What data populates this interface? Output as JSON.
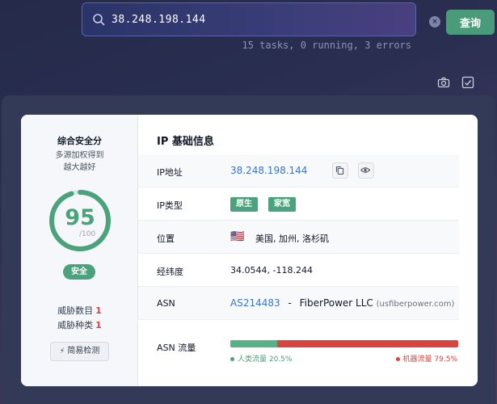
{
  "search": {
    "value": "38.248.198.144",
    "clear_label": "×",
    "button_label": "查询"
  },
  "task_status": "15 tasks, 0 running, 3 errors",
  "toolbar": {
    "icons": [
      "camera-icon",
      "checkbox-icon"
    ]
  },
  "score": {
    "title": "综合安全分",
    "subtitle_line1": "多源加权得到",
    "subtitle_line2": "越大越好",
    "value": "95",
    "max": "/100",
    "fraction": 0.95,
    "badge": "安全",
    "threat_count_label": "威胁数目",
    "threat_count": "1",
    "threat_types_label": "威胁种类",
    "threat_types": "1",
    "simple_check_label": "简易检测"
  },
  "info": {
    "title": "IP 基础信息",
    "ip_label": "IP地址",
    "ip_value": "38.248.198.144",
    "type_label": "IP类型",
    "types": [
      "原生",
      "家宽"
    ],
    "location_label": "位置",
    "location_flag": "🇺🇸",
    "location_value": "美国, 加州, 洛杉矶",
    "coords_label": "经纬度",
    "coords_value": "34.0544, -118.244",
    "asn_label": "ASN",
    "asn_number": "AS214483",
    "asn_separator": "-",
    "asn_org": "FiberPower LLC",
    "asn_domain": "(usfiberpower.com)",
    "traffic_label": "ASN 流量",
    "human_traffic_label": "人类流量 20.5%",
    "human_traffic_pct": 20.5,
    "bot_traffic_label": "机器流量 79.5%",
    "bot_traffic_pct": 79.5
  },
  "colors": {
    "accent_green": "#4aa37c",
    "danger_red": "#d9453e",
    "link_blue": "#3b74c9"
  }
}
